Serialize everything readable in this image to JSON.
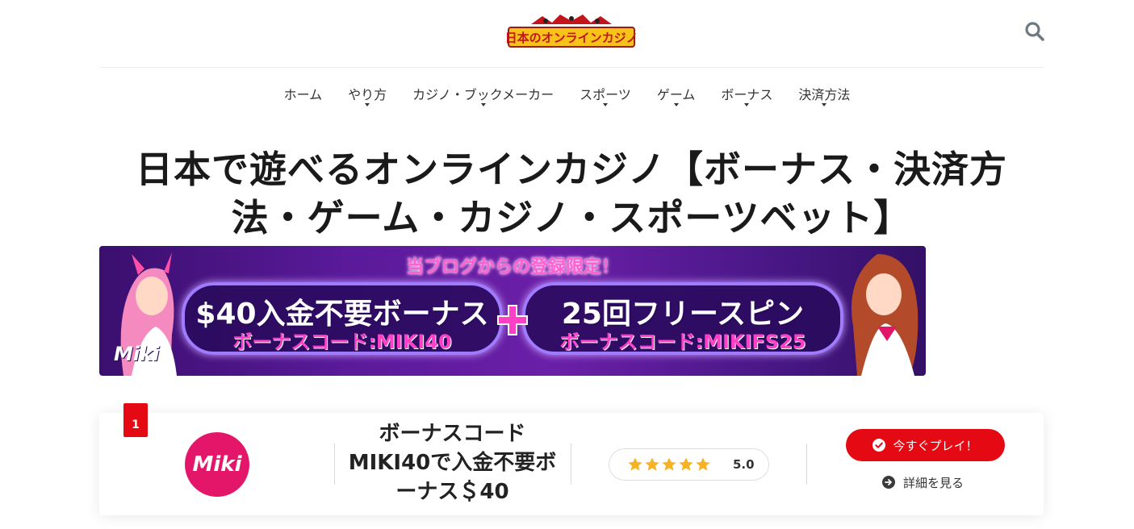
{
  "header": {
    "logo_text": "日本のオンラインカジノ",
    "search_icon": "search-icon"
  },
  "nav": {
    "items": [
      {
        "label": "ホーム",
        "has_dropdown": false
      },
      {
        "label": "やり方",
        "has_dropdown": true
      },
      {
        "label": "カジノ・ブックメーカー",
        "has_dropdown": true
      },
      {
        "label": "スポーツ",
        "has_dropdown": true
      },
      {
        "label": "ゲーム",
        "has_dropdown": true
      },
      {
        "label": "ボーナス",
        "has_dropdown": true
      },
      {
        "label": "決済方法",
        "has_dropdown": true
      }
    ]
  },
  "page": {
    "title": "日本で遊べるオンラインカジノ【ボーナス・決済方法・ゲーム・カジノ・スポーツベット】"
  },
  "banner": {
    "headline": "当ブログからの登録限定！",
    "offer_left": "$40入金不要ボーナス",
    "code_left": "ボーナスコード:MIKI40",
    "offer_right": "25回フリースピン",
    "code_right": "ボーナスコード:MIKIFS25",
    "brand": "Miki"
  },
  "casino_card": {
    "rank": "1",
    "logo_text": "Miki",
    "bonus_text": "ボーナスコードMIKI40で入金不要ボーナス＄40",
    "rating_value": "5.0",
    "rating_stars": 5,
    "play_button_label": "今すぐプレイ！",
    "details_link_label": "詳細を見る"
  },
  "colors": {
    "accent_red": "#e50914",
    "brand_pink": "#e3166a",
    "star_gold": "#f5b325",
    "banner_purple": "#5a1a9a"
  }
}
